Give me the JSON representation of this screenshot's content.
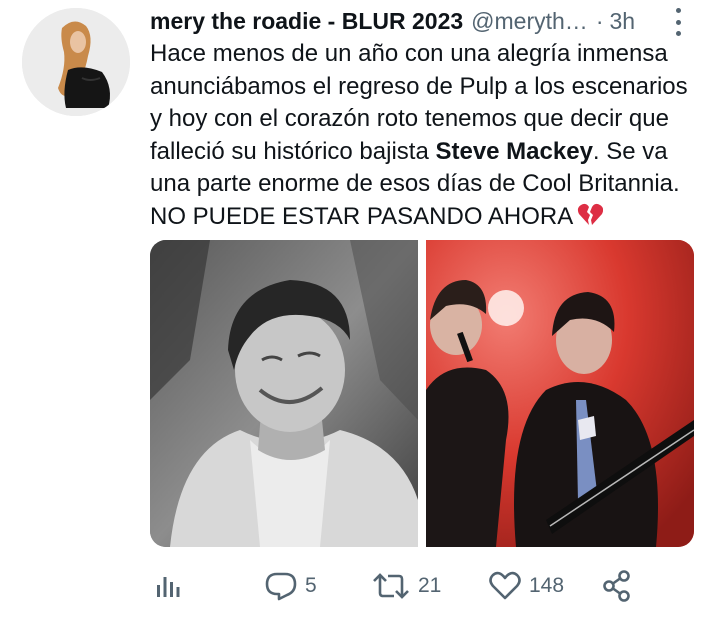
{
  "tweet": {
    "display_name": "mery the roadie - BLUR 2023",
    "handle": "@meryth…",
    "separator": "·",
    "time": "3h",
    "text": {
      "line1": "Hace menos de un año con una alegría inmensa",
      "line2": "anunciábamos el regreso de Pulp a los escenarios",
      "line3": "y hoy con el corazón roto tenemos que decir que",
      "line4_before": "falleció su histórico bajista ",
      "line4_bold": "Steve Mackey",
      "line4_after": ". Se va",
      "line5": "una parte enorme de esos días de Cool Britannia.",
      "line6": "NO PUEDE ESTAR PASANDO AHORA",
      "emoji": "broken-heart"
    },
    "media": [
      {
        "icon": "black-and-white-portrait-photo"
      },
      {
        "icon": "band-on-stage-photo"
      }
    ],
    "actions": {
      "analytics_icon": "analytics-icon",
      "replies": "5",
      "retweets": "21",
      "likes": "148",
      "share_icon": "share-icon"
    }
  },
  "colors": {
    "text": "#0f1419",
    "secondary": "#536471",
    "background": "#ffffff"
  }
}
